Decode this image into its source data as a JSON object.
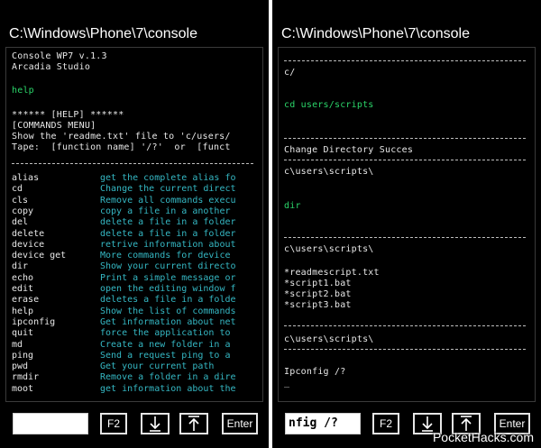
{
  "left": {
    "title": "C:\\Windows\\Phone\\7\\console",
    "header": [
      "Console WP7 v.1.3",
      "Arcadia Studio"
    ],
    "input_echo": "help",
    "help_header": "****** [HELP] ******",
    "commands_menu": "[COMMANDS MENU]",
    "help_text": [
      "Show the 'readme.txt' file to 'c/users/",
      "Tape:  [function name] '/?'  or  [funct"
    ],
    "commands": [
      {
        "cmd": "alias",
        "desc": "get the complete alias fo"
      },
      {
        "cmd": "cd",
        "desc": "Change the current direct"
      },
      {
        "cmd": "cls",
        "desc": "Remove all commands execu"
      },
      {
        "cmd": "copy",
        "desc": "copy a file in a another"
      },
      {
        "cmd": "del",
        "desc": "delete a file in a folder"
      },
      {
        "cmd": "delete",
        "desc": "delete a file in a folder"
      },
      {
        "cmd": "device",
        "desc": "retrive information about"
      },
      {
        "cmd": "device get",
        "desc": "More commands for device"
      },
      {
        "cmd": "dir",
        "desc": "Show your current directo"
      },
      {
        "cmd": "echo",
        "desc": "Print a simple message or"
      },
      {
        "cmd": "edit",
        "desc": "open the editing window f"
      },
      {
        "cmd": "erase",
        "desc": "deletes a file in a folde"
      },
      {
        "cmd": "help",
        "desc": "Show the list of commands"
      },
      {
        "cmd": "ipconfig",
        "desc": "Get information about net"
      },
      {
        "cmd": "quit",
        "desc": "force the application to"
      },
      {
        "cmd": "md",
        "desc": "Create a new folder in a"
      },
      {
        "cmd": "ping",
        "desc": "Send a request ping to a"
      },
      {
        "cmd": "pwd",
        "desc": "Get your current path"
      },
      {
        "cmd": "rmdir",
        "desc": "Remove a folder in a dire"
      },
      {
        "cmd": "moot",
        "desc": "get information about the"
      }
    ],
    "input_value": "",
    "buttons": {
      "f2": "F2",
      "enter": "Enter"
    }
  },
  "right": {
    "title": "C:\\Windows\\Phone\\7\\console",
    "path1": "c/",
    "input1": "cd users/scripts",
    "status": "Change Directory Succes",
    "path2": "c\\users\\scripts\\",
    "input2": "dir",
    "path3": "c\\users\\scripts\\",
    "files": [
      "*readmescript.txt",
      "*script1.bat",
      "*script2.bat",
      "*script3.bat"
    ],
    "path4": "c\\users\\scripts\\",
    "input3": "Ipconfig /?",
    "prompt": "_",
    "input_value": "nfig /?",
    "buttons": {
      "f2": "F2",
      "enter": "Enter"
    }
  },
  "watermark": "PocketHacks.com"
}
